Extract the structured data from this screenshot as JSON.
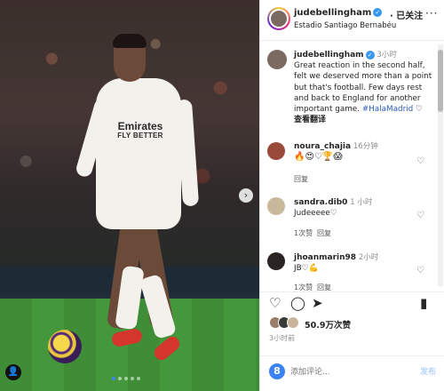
{
  "post": {
    "username": "judebellingham",
    "follow_label": "· 已关注",
    "location": "Estadio Santiago Bernabéu",
    "more_label": "···"
  },
  "jersey": {
    "brand": "Emirates",
    "slogan": "FLY BETTER"
  },
  "caption": {
    "username": "judebellingham",
    "time": "3小时",
    "text_before": "Great reaction in the second half, felt we deserved more than a point but that's football. Few days rest and back to England for another important game. ",
    "hashtag": "#HalaMadrid",
    "translation_label": "查看翻译"
  },
  "comments": [
    {
      "username": "noura_chajia",
      "time": "16分钟",
      "text": "🔥😍♡🏆😱",
      "reply_label": "回复"
    },
    {
      "username": "sandra.dib0",
      "time": "1 小时",
      "text": "Judeeeee♡",
      "likes_label": "1次赞",
      "reply_label": "回复"
    },
    {
      "username": "jhoanmarin98",
      "time": "2小时",
      "text": "JB♡💪",
      "likes_label": "1次赞",
      "reply_label": "回复"
    }
  ],
  "likes": {
    "count_label": "50.9万次赞"
  },
  "post_time": "3小时前",
  "comment_input": {
    "placeholder": "添加评论...",
    "post_label": "发布"
  },
  "icons": {
    "next": "chevron-right-icon",
    "tag": "person-tag-icon",
    "like": "heart-icon",
    "comment": "comment-icon",
    "share": "send-icon",
    "save": "bookmark-icon",
    "emoji": "emoji-icon"
  },
  "colors": {
    "verified": "#3897f0",
    "hashtag": "#2b5cb8",
    "pitch": "#3f8d36"
  }
}
